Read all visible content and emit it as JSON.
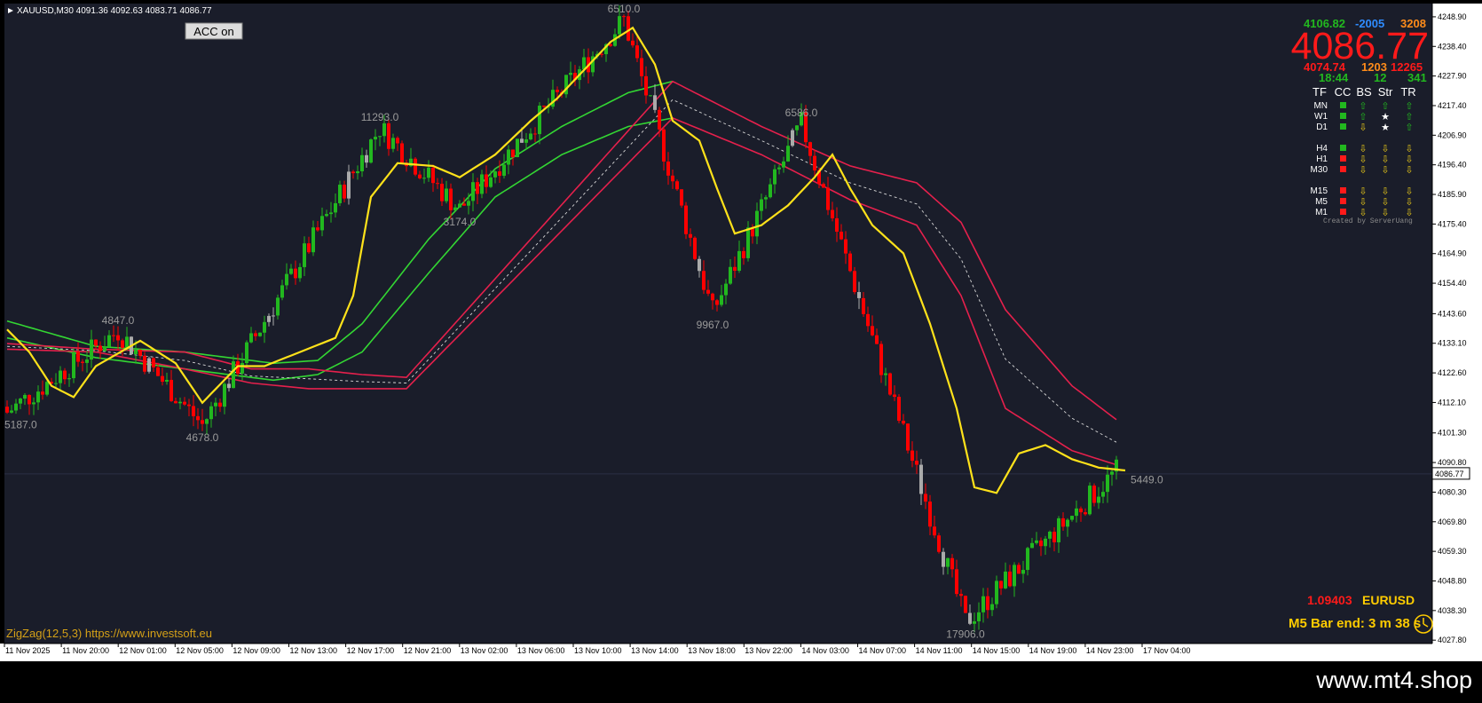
{
  "header": {
    "symbol_line": "XAUUSD,M30  4091.36 4092.63 4083.71 4086.77"
  },
  "acc_button": {
    "label": "ACC on"
  },
  "info_panel": {
    "row1": [
      "4106.82",
      "-2005",
      "3208"
    ],
    "big_price": "4086.77",
    "row3": [
      "4074.74",
      "1203",
      "12265"
    ],
    "row4": [
      "18:44",
      "12",
      "341"
    ],
    "table_headers": [
      "TF",
      "CC",
      "BS",
      "Str",
      "TR"
    ],
    "groups": [
      [
        {
          "tf": "MN",
          "cc": "green",
          "bs": "up",
          "str": "up",
          "tr": "up"
        },
        {
          "tf": "W1",
          "cc": "green",
          "bs": "up",
          "str": "star",
          "tr": "up"
        },
        {
          "tf": "D1",
          "cc": "green",
          "bs": "down",
          "str": "star",
          "tr": "up"
        }
      ],
      [
        {
          "tf": "H4",
          "cc": "green",
          "bs": "down",
          "str": "down",
          "tr": "down"
        },
        {
          "tf": "H1",
          "cc": "red",
          "bs": "down",
          "str": "down",
          "tr": "down"
        },
        {
          "tf": "M30",
          "cc": "red",
          "bs": "down",
          "str": "down",
          "tr": "down"
        }
      ],
      [
        {
          "tf": "M15",
          "cc": "red",
          "bs": "down",
          "str": "down",
          "tr": "down"
        },
        {
          "tf": "M5",
          "cc": "red",
          "bs": "down",
          "str": "down",
          "tr": "down"
        },
        {
          "tf": "M1",
          "cc": "red",
          "bs": "down",
          "str": "down",
          "tr": "down"
        }
      ]
    ],
    "credit": "Created by ServerUang"
  },
  "bottom_right": {
    "eur_value": "1.09403",
    "eur_symbol": "EURUSD",
    "bar_end": "M5 Bar end: 3 m 38 s"
  },
  "zigzag_label": "ZigZag(12,5,3) https://www.investsoft.eu",
  "watermark": "www.mt4.shop",
  "current_price_label": "4086.77",
  "colors": {
    "background": "#1a1d2a",
    "bull": "#22b81f",
    "bear": "#ff0000",
    "neutral": "#aaaaaa",
    "yellow_line": "#ffe21a",
    "green_band": "#33d633",
    "red_band": "#e5204c",
    "zigzag_text": "#9a9a9a"
  },
  "chart_data": {
    "type": "candlestick",
    "symbol": "XAUUSD",
    "timeframe": "M30",
    "ylim": [
      4026.6,
      4253.6
    ],
    "y_ticks": [
      "4248.90",
      "4238.40",
      "4227.90",
      "4217.40",
      "4206.90",
      "4196.40",
      "4185.90",
      "4175.40",
      "4164.90",
      "4154.40",
      "4143.60",
      "4133.10",
      "4122.60",
      "4112.10",
      "4101.30",
      "4090.80",
      "4080.30",
      "4069.80",
      "4059.30",
      "4048.80",
      "4038.30",
      "4027.80"
    ],
    "x_ticks": [
      "11 Nov 2025",
      "11 Nov 20:00",
      "12 Nov 01:00",
      "12 Nov 05:00",
      "12 Nov 09:00",
      "12 Nov 13:00",
      "12 Nov 17:00",
      "12 Nov 21:00",
      "13 Nov 02:00",
      "13 Nov 06:00",
      "13 Nov 10:00",
      "13 Nov 14:00",
      "13 Nov 18:00",
      "13 Nov 22:00",
      "14 Nov 03:00",
      "14 Nov 07:00",
      "14 Nov 11:00",
      "14 Nov 15:00",
      "14 Nov 19:00",
      "14 Nov 23:00",
      "17 Nov 04:00"
    ],
    "zigzag_points": [
      {
        "bar": 0,
        "price": 4108.6,
        "label": "5187.0",
        "pos": "below"
      },
      {
        "bar": 25,
        "price": 4137.5,
        "label": "4847.0",
        "pos": "above"
      },
      {
        "bar": 44,
        "price": 4104.1,
        "label": "4678.0",
        "pos": "below"
      },
      {
        "bar": 84,
        "price": 4209.6,
        "label": "11293.0",
        "pos": "above"
      },
      {
        "bar": 102,
        "price": 4180.6,
        "label": "3174.0",
        "pos": "below"
      },
      {
        "bar": 139,
        "price": 4247.9,
        "label": "6510.0",
        "pos": "above"
      },
      {
        "bar": 159,
        "price": 4144.1,
        "label": "9967.0",
        "pos": "below"
      },
      {
        "bar": 179,
        "price": 4211.1,
        "label": "6586.0",
        "pos": "above"
      },
      {
        "bar": 216,
        "price": 4034.3,
        "label": "17906.0",
        "pos": "below"
      },
      {
        "bar": 250,
        "price": 4087.8,
        "label": "5449.0",
        "pos": "right"
      }
    ],
    "last_price": 4086.77,
    "ma_anchor_prices": {
      "yellow": [
        [
          0,
          4138
        ],
        [
          5,
          4130
        ],
        [
          10,
          4118
        ],
        [
          15,
          4114
        ],
        [
          20,
          4125
        ],
        [
          30,
          4134
        ],
        [
          38,
          4126
        ],
        [
          44,
          4112
        ],
        [
          52,
          4125
        ],
        [
          58,
          4125
        ],
        [
          66,
          4130
        ],
        [
          74,
          4135
        ],
        [
          78,
          4150
        ],
        [
          82,
          4185
        ],
        [
          88,
          4197
        ],
        [
          96,
          4196
        ],
        [
          102,
          4192
        ],
        [
          110,
          4200
        ],
        [
          118,
          4212
        ],
        [
          124,
          4220
        ],
        [
          130,
          4230
        ],
        [
          136,
          4240
        ],
        [
          141,
          4245
        ],
        [
          146,
          4232
        ],
        [
          150,
          4212
        ],
        [
          156,
          4205
        ],
        [
          160,
          4188
        ],
        [
          164,
          4172
        ],
        [
          170,
          4175
        ],
        [
          176,
          4182
        ],
        [
          182,
          4192
        ],
        [
          186,
          4200
        ],
        [
          190,
          4188
        ],
        [
          195,
          4175
        ],
        [
          202,
          4165
        ],
        [
          208,
          4140
        ],
        [
          214,
          4110
        ],
        [
          218,
          4082
        ],
        [
          223,
          4080
        ],
        [
          228,
          4094
        ],
        [
          234,
          4097
        ],
        [
          240,
          4092
        ],
        [
          246,
          4089
        ],
        [
          252,
          4088
        ]
      ],
      "green_upper": [
        [
          0,
          4141
        ],
        [
          20,
          4132
        ],
        [
          40,
          4130
        ],
        [
          60,
          4126
        ],
        [
          70,
          4127
        ],
        [
          80,
          4140
        ],
        [
          95,
          4170
        ],
        [
          110,
          4195
        ],
        [
          125,
          4210
        ],
        [
          140,
          4222
        ],
        [
          150,
          4226
        ]
      ],
      "green_lower": [
        [
          0,
          4135
        ],
        [
          20,
          4128
        ],
        [
          40,
          4124
        ],
        [
          60,
          4120
        ],
        [
          70,
          4122
        ],
        [
          80,
          4130
        ],
        [
          95,
          4158
        ],
        [
          110,
          4185
        ],
        [
          125,
          4200
        ],
        [
          140,
          4210
        ],
        [
          150,
          4213
        ]
      ],
      "red_upper": [
        [
          0,
          4133
        ],
        [
          20,
          4131
        ],
        [
          40,
          4130
        ],
        [
          55,
          4124
        ],
        [
          68,
          4124
        ],
        [
          80,
          4122
        ],
        [
          90,
          4121
        ],
        [
          150,
          4226
        ],
        [
          170,
          4210
        ],
        [
          190,
          4196
        ],
        [
          205,
          4190
        ],
        [
          215,
          4176
        ],
        [
          225,
          4145
        ],
        [
          240,
          4118
        ],
        [
          250,
          4106
        ]
      ],
      "red_lower": [
        [
          0,
          4131
        ],
        [
          20,
          4130
        ],
        [
          40,
          4124
        ],
        [
          55,
          4119
        ],
        [
          68,
          4117
        ],
        [
          80,
          4117
        ],
        [
          90,
          4117
        ],
        [
          150,
          4213
        ],
        [
          170,
          4200
        ],
        [
          190,
          4184
        ],
        [
          205,
          4175
        ],
        [
          215,
          4150
        ],
        [
          225,
          4110
        ],
        [
          240,
          4095
        ],
        [
          250,
          4090
        ]
      ]
    }
  }
}
